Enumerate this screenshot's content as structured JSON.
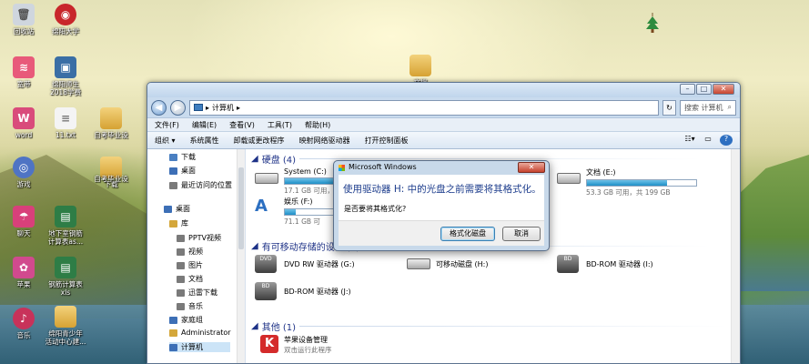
{
  "desktop": {
    "icons": [
      {
        "label": "回收站",
        "glyph": "🗑"
      },
      {
        "label": "绵阳大学",
        "glyph": "◉"
      },
      {
        "label": "宽带",
        "glyph": "≋"
      },
      {
        "label": "绵阳师生\n2018学费",
        "glyph": "▣"
      },
      {
        "label": "word",
        "glyph": "W"
      },
      {
        "label": "11.txt",
        "glyph": "≡"
      },
      {
        "label": "自考毕业设",
        "glyph": ""
      },
      {
        "label": "下载",
        "glyph": ""
      },
      {
        "label": "游戏",
        "glyph": "◎"
      },
      {
        "label": "自考毕业设",
        "glyph": ""
      },
      {
        "label": "聊天",
        "glyph": "☂"
      },
      {
        "label": "地下室钢筋\n计算表as...",
        "glyph": "▤"
      },
      {
        "label": "苹果",
        "glyph": "✿"
      },
      {
        "label": "钢筋计算表\nxls",
        "glyph": "▤"
      },
      {
        "label": "音乐",
        "glyph": "♪"
      },
      {
        "label": "绵阳青少年\n活动中心建...",
        "glyph": ""
      },
      {
        "label": "文档",
        "glyph": ""
      }
    ]
  },
  "explorer": {
    "address": [
      "计算机",
      "▸"
    ],
    "search_placeholder": "搜索 计算机",
    "menu": [
      "文件(F)",
      "编辑(E)",
      "查看(V)",
      "工具(T)",
      "帮助(H)"
    ],
    "commands": [
      "组织 ▾",
      "系统属性",
      "卸载或更改程序",
      "映射网络驱动器",
      "打开控制面板"
    ],
    "nav_items": [
      {
        "label": "下载",
        "color": "#4a7fc1"
      },
      {
        "label": "桌面",
        "color": "#3d6fb6"
      },
      {
        "label": "最近访问的位置",
        "color": "#7a7a7a"
      },
      {
        "label": "桌面",
        "color": "#3d6fb6"
      },
      {
        "label": "库",
        "color": "#d4a73b"
      },
      {
        "label": "PPTV视频",
        "color": "#7a7a7a"
      },
      {
        "label": "视频",
        "color": "#7a7a7a"
      },
      {
        "label": "图片",
        "color": "#7a7a7a"
      },
      {
        "label": "文档",
        "color": "#7a7a7a"
      },
      {
        "label": "迅雷下载",
        "color": "#7a7a7a"
      },
      {
        "label": "音乐",
        "color": "#7a7a7a"
      },
      {
        "label": "家庭组",
        "color": "#3d6fb6"
      },
      {
        "label": "Administrator",
        "color": "#d4a73b"
      },
      {
        "label": "计算机",
        "color": "#3d6fb6"
      }
    ],
    "groups": {
      "hdd": "硬盘 (4)",
      "removable": "有可移动存储的设备 (4)",
      "other": "其他 (1)"
    },
    "drives": [
      {
        "name": "System (C:)",
        "size": "17.1 GB 可用，共 48.6 GB",
        "used": 0.65
      },
      {
        "name": "文档 (E:)",
        "size": "53.3 GB 可用，共 199 GB",
        "used": 0.73
      },
      {
        "name": "娱乐 (F:)",
        "size": "71.1 GB 可",
        "used": 0.2
      }
    ],
    "removable": [
      {
        "name": "DVD RW 驱动器 (G:)",
        "tag": "DVD"
      },
      {
        "name": "可移动磁盘 (H:)",
        "tag": ""
      },
      {
        "name": "BD-ROM 驱动器 (I:)",
        "tag": "BD"
      },
      {
        "name": "BD-ROM 驱动器 (J:)",
        "tag": "BD"
      }
    ],
    "other": [
      {
        "name": "苹果设备管理",
        "sub": "双击运行此程序"
      }
    ]
  },
  "dialog": {
    "title": "Microsoft Windows",
    "message": "使用驱动器 H: 中的光盘之前需要将其格式化。",
    "question": "是否要将其格式化?",
    "format_label": "格式化磁盘",
    "cancel_label": "取消"
  }
}
